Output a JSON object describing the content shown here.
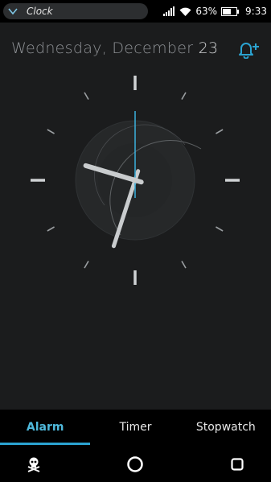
{
  "status_bar": {
    "app_title": "Clock",
    "battery_percent": "63%",
    "time": "9:33"
  },
  "header": {
    "date_text": "Wednesday, December",
    "day_number": "23"
  },
  "clock": {
    "hour": 9,
    "minute": 33,
    "second": 0
  },
  "tabs": [
    {
      "label": "Alarm",
      "active": true
    },
    {
      "label": "Timer",
      "active": false
    },
    {
      "label": "Stopwatch",
      "active": false
    }
  ],
  "colors": {
    "accent": "#2ba3d1",
    "background": "#1b1c1d",
    "hand": "#c9ccce"
  },
  "nav_icons": [
    "skull-icon",
    "home-circle-icon",
    "recents-square-icon"
  ]
}
